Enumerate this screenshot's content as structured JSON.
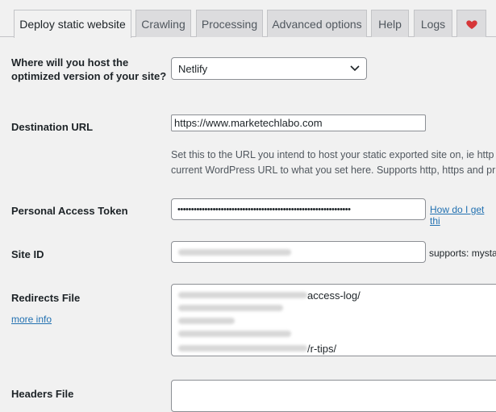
{
  "tabs": [
    {
      "label": "Deploy static website",
      "active": true
    },
    {
      "label": "Crawling"
    },
    {
      "label": "Processing"
    },
    {
      "label": "Advanced options"
    },
    {
      "label": "Help"
    },
    {
      "label": "Logs"
    }
  ],
  "favorite_tab": {
    "icon": "heart-icon",
    "color": "#d63638"
  },
  "hosting": {
    "label_line1": "Where will you host the",
    "label_line2": "optimized version of your site?",
    "selected": "Netlify"
  },
  "destination": {
    "label": "Destination URL",
    "value": "https://www.marketechlabo.com",
    "help_line1": "Set this to the URL you intend to host your static exported site on, ie http",
    "help_line2": "current WordPress URL to what you set here. Supports http, https and pr"
  },
  "token": {
    "label": "Personal Access Token",
    "masked_value": "••••••••••••••••••••••••••••••••••••••••••••••••••••••••••••••••",
    "help_link": "How do I get thi"
  },
  "site_id": {
    "label": "Site ID",
    "supports_text": "supports: mysta"
  },
  "redirects": {
    "label": "Redirects File",
    "more_info": "more info",
    "visible_fragments": [
      "access-log/",
      "/r-tips/"
    ]
  },
  "headers": {
    "label": "Headers File"
  }
}
